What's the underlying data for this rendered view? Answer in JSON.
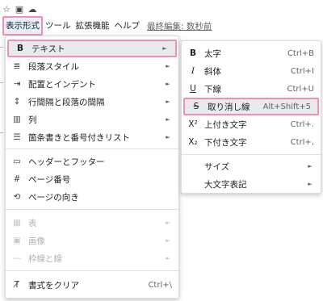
{
  "menubar": {
    "items": [
      "表示形式",
      "ツール",
      "拡張機能",
      "ヘルプ"
    ],
    "last_edit": "最終編集: 数秒前"
  },
  "main_menu": {
    "text": {
      "icon": "B",
      "label": "テキスト"
    },
    "paragraph_style": {
      "label": "段落スタイル"
    },
    "align_indent": {
      "label": "配置とインデント"
    },
    "line_spacing": {
      "label": "行間隔と段落の間隔"
    },
    "columns": {
      "label": "列"
    },
    "bullets": {
      "label": "箇条書きと番号付きリスト"
    },
    "header_footer": {
      "label": "ヘッダーとフッター"
    },
    "page_numbers": {
      "icon": "#",
      "label": "ページ番号"
    },
    "orientation": {
      "label": "ページの向き"
    },
    "table": {
      "label": "表"
    },
    "image": {
      "label": "画像"
    },
    "borders": {
      "label": "枠線と線"
    },
    "clear_formatting": {
      "label": "書式をクリア",
      "shortcut": "Ctrl+\\"
    }
  },
  "sub_menu": {
    "bold": {
      "icon": "B",
      "label": "太字",
      "shortcut": "Ctrl+B"
    },
    "italic": {
      "icon": "I",
      "label": "斜体",
      "shortcut": "Ctrl+I"
    },
    "underline": {
      "icon": "U",
      "label": "下線",
      "shortcut": "Ctrl+U"
    },
    "strikethrough": {
      "icon": "S",
      "label": "取り消し線",
      "shortcut": "Alt+Shift+5"
    },
    "superscript": {
      "icon": "X²",
      "label": "上付き文字",
      "shortcut": "Ctrl+."
    },
    "subscript": {
      "icon": "X₂",
      "label": "下付き文字",
      "shortcut": "Ctrl+,"
    },
    "size": {
      "label": "サイズ"
    },
    "capitalization": {
      "label": "大文字表記"
    }
  }
}
